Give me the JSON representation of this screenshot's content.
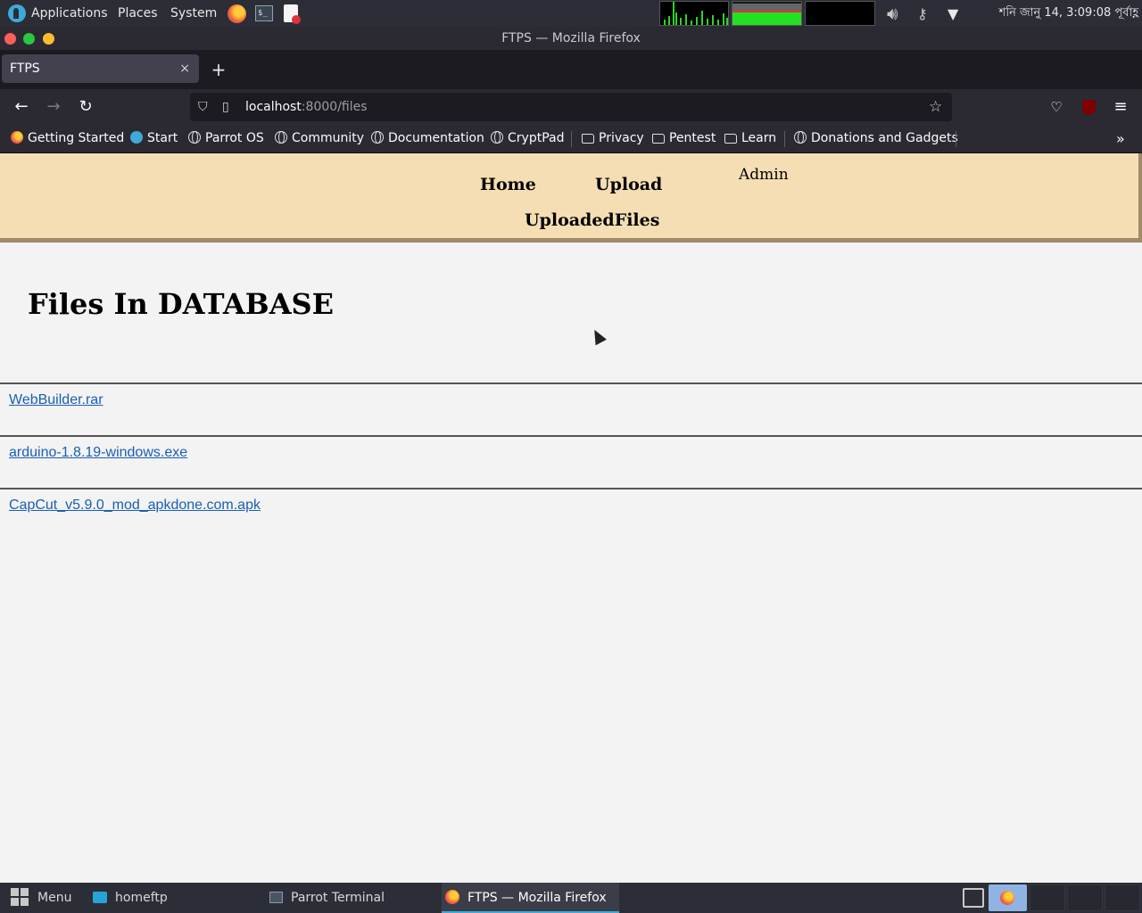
{
  "system_panel": {
    "menus": [
      "Applications",
      "Places",
      "System"
    ],
    "clock": "শনি জানু 14,  3:09:08 পূর্বাহ্ণ"
  },
  "browser": {
    "window_title": "FTPS — Mozilla Firefox",
    "tab": {
      "label": "FTPS",
      "close": "×"
    },
    "new_tab": "+",
    "url": {
      "host": "localhost",
      "path": ":8000/files"
    },
    "bookmarks": [
      {
        "label": "Getting Started",
        "icon": "firefox-icon"
      },
      {
        "label": "Start",
        "icon": "parrot-icon"
      },
      {
        "label": "Parrot OS",
        "icon": "globe-icon"
      },
      {
        "label": "Community",
        "icon": "globe-icon"
      },
      {
        "label": "Documentation",
        "icon": "globe-icon"
      },
      {
        "label": "CryptPad",
        "icon": "globe-icon"
      },
      {
        "label": "Privacy",
        "icon": "folder-icon"
      },
      {
        "label": "Pentest",
        "icon": "folder-icon"
      },
      {
        "label": "Learn",
        "icon": "folder-icon"
      },
      {
        "label": "Donations and Gadgets",
        "icon": "globe-icon"
      }
    ]
  },
  "site": {
    "nav": {
      "home": "Home",
      "upload": "Upload",
      "admin": "Admin",
      "uploaded_files": "UploadedFiles"
    },
    "heading": "Files In DATABASE",
    "files": [
      "WebBuilder.rar",
      "arduino-1.8.19-windows.exe",
      "CapCut_v5.9.0_mod_apkdone.com.apk"
    ]
  },
  "taskbar": {
    "menu": "Menu",
    "tasks": [
      "homeftp",
      "Parrot Terminal",
      "FTPS — Mozilla Firefox"
    ]
  },
  "colors": {
    "nav_bg": "#f5deb3",
    "page_bg": "#f3f3f3",
    "link": "#1a5fb4",
    "panel": "#2b2e37"
  }
}
